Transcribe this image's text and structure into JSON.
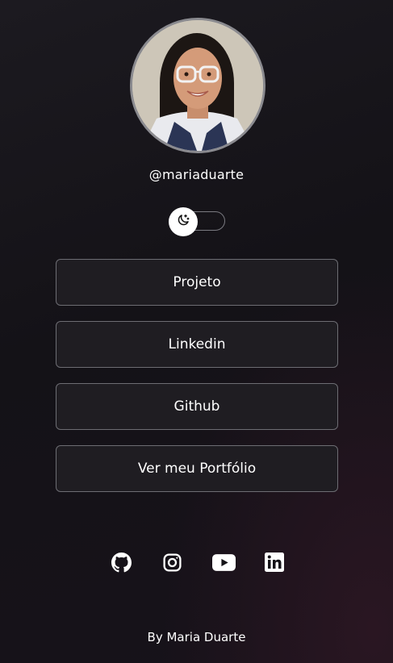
{
  "profile": {
    "username": "@mariaduarte"
  },
  "theme_toggle": {
    "icon": "moon-stars-icon",
    "mode": "dark"
  },
  "links": [
    {
      "label": "Projeto"
    },
    {
      "label": "Linkedin"
    },
    {
      "label": "Github"
    },
    {
      "label": "Ver meu Portfólio"
    }
  ],
  "social": [
    {
      "icon": "github-icon"
    },
    {
      "icon": "instagram-icon"
    },
    {
      "icon": "youtube-icon"
    },
    {
      "icon": "linkedin-icon"
    }
  ],
  "footer": {
    "text": "By Maria Duarte"
  },
  "colors": {
    "background": "#151318",
    "button_bg": "#1f1d22",
    "button_border": "#6d6d73",
    "text": "#ffffff"
  }
}
